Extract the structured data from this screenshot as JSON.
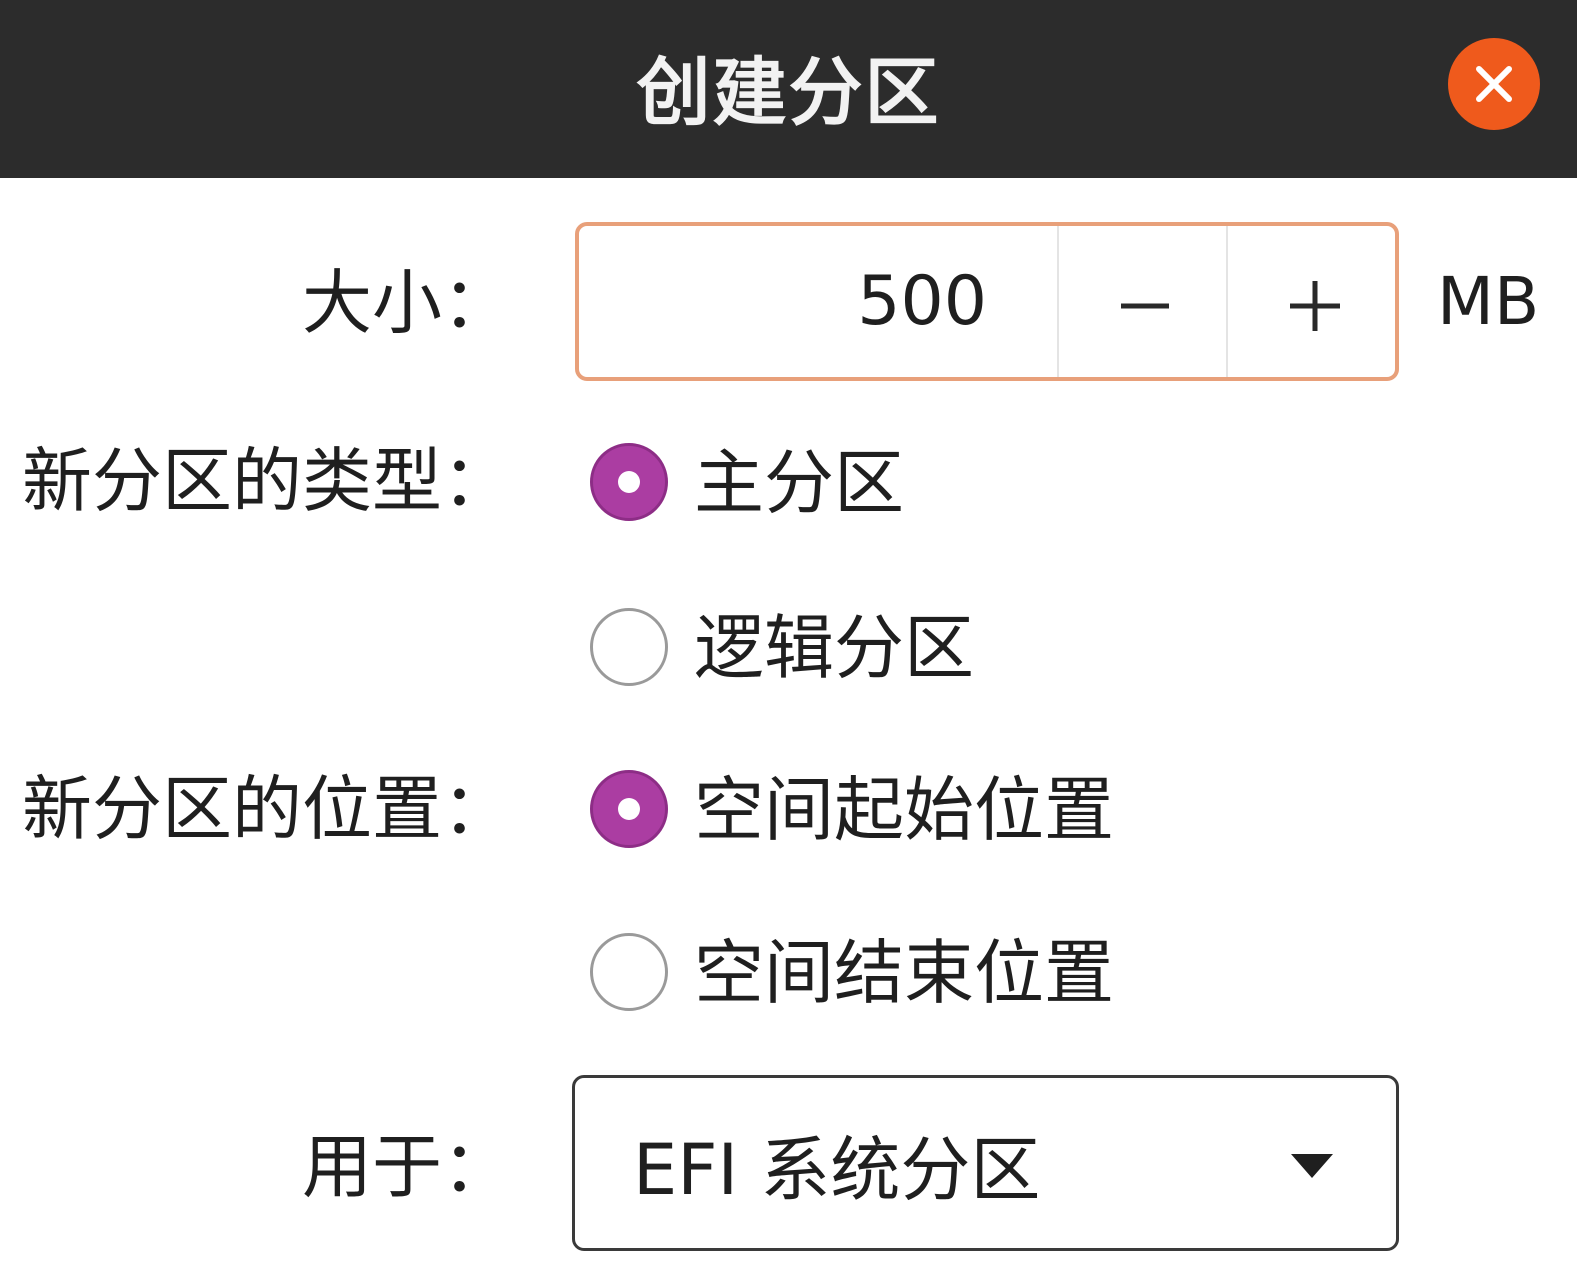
{
  "dialog": {
    "title": "创建分区",
    "close_icon": "close-icon",
    "close_color": "#ef5a1c",
    "titlebar_color": "#2c2c2c"
  },
  "size": {
    "label": "大小：",
    "value": "500",
    "decrement_icon": "minus-icon",
    "increment_icon": "plus-icon",
    "unit": "MB",
    "focus_border_color": "#e8a07a"
  },
  "type": {
    "label": "新分区的类型：",
    "options": [
      {
        "label": "主分区",
        "checked": true
      },
      {
        "label": "逻辑分区",
        "checked": false
      }
    ]
  },
  "location": {
    "label": "新分区的位置：",
    "options": [
      {
        "label": "空间起始位置",
        "checked": true
      },
      {
        "label": "空间结束位置",
        "checked": false
      }
    ]
  },
  "use_as": {
    "label": "用于：",
    "selected": "EFI 系统分区",
    "dropdown_icon": "dropdown-arrow-icon"
  },
  "accent_color": "#ab3da2"
}
